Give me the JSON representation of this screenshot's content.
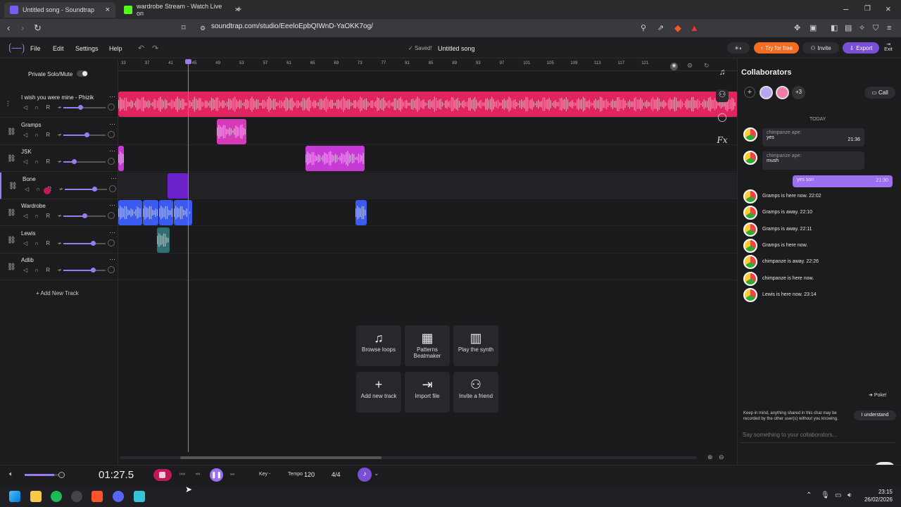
{
  "browser": {
    "tabs": [
      {
        "title": "Untitled song - Soundtrap",
        "active": true,
        "favicon": "soundtrap-icon"
      },
      {
        "title": "wardrobe Stream - Watch Live on",
        "active": false,
        "favicon": "kick-icon"
      }
    ],
    "url": "soundtrap.com/studio/EeeloEpbQIWnD-YaOKK7og/"
  },
  "app": {
    "menu": [
      "File",
      "Edit",
      "Settings",
      "Help"
    ],
    "saved": "Saved!",
    "title": "Untitled song",
    "try_free": "Try for free",
    "invite": "Invite",
    "export": "Export",
    "exit": "Exit",
    "private_solo": "Private Solo/Mute"
  },
  "tracks": [
    {
      "name": "I wish you were mine - Phizik",
      "vol": 0.4,
      "color": "#e0245e"
    },
    {
      "name": "Gramps",
      "vol": 0.55,
      "color": "#d63ab8"
    },
    {
      "name": "JSK",
      "vol": 0.25,
      "color": "#c83ad6"
    },
    {
      "name": "Bone",
      "vol": 0.7,
      "color": "#6a21c9"
    },
    {
      "name": "Wardrobe",
      "vol": 0.5,
      "color": "#3b5bf0"
    },
    {
      "name": "Lewis",
      "vol": 0.7,
      "color": "#2f6f73"
    },
    {
      "name": "Adlib",
      "vol": 0.7,
      "color": "#555"
    }
  ],
  "track_controls": "R",
  "add_track": "+ Add New Track",
  "ruler_ticks": [
    "33",
    "37",
    "41",
    "45",
    "49",
    "53",
    "57",
    "61",
    "65",
    "69",
    "73",
    "77",
    "81",
    "85",
    "89",
    "93",
    "97",
    "101",
    "105",
    "109",
    "113",
    "117",
    "121"
  ],
  "tiles": [
    {
      "label": "Browse loops",
      "icon": "music-note-icon",
      "glyph": "♫"
    },
    {
      "label": "Patterns Beatmaker",
      "icon": "grid-icon",
      "glyph": "▦"
    },
    {
      "label": "Play the synth",
      "icon": "piano-icon",
      "glyph": "▥"
    },
    {
      "label": "Add new track",
      "icon": "plus-icon",
      "glyph": "+"
    },
    {
      "label": "Import file",
      "icon": "import-icon",
      "glyph": "⇥"
    },
    {
      "label": "Invite a friend",
      "icon": "add-user-icon",
      "glyph": "⚇"
    }
  ],
  "collab": {
    "title": "Collaborators",
    "more_count": "+3",
    "call": "Call",
    "today": "TODAY",
    "messages": [
      {
        "from": "chimpanze ape:",
        "text": "yes",
        "time": "21:36"
      },
      {
        "from": "chimpanze ape:",
        "text": "mush",
        "time": ""
      }
    ],
    "own_message": {
      "text": "yes son",
      "time": "21:30"
    },
    "events": [
      "Gramps is here now. 22:02",
      "Gramps is away. 22:10",
      "Gramps is away. 22:11",
      "Gramps is here now.",
      "chimpanze is away. 22:26",
      "chimpanze is here now.",
      "Lewis is here now. 23:14"
    ],
    "poke": "Poke!",
    "disclaimer": "Keep in mind, anything shared in this chat may be recorded by the other user(s) without you knowing.",
    "understand": "I understand",
    "placeholder": "Say something to your collaborators..."
  },
  "transport": {
    "time": "01:27.5",
    "key": "Key -",
    "tempo_label": "Tempo",
    "tempo": "120",
    "signature": "4/4"
  },
  "taskbar": {
    "time": "23:15",
    "date": "26/02/2026"
  }
}
